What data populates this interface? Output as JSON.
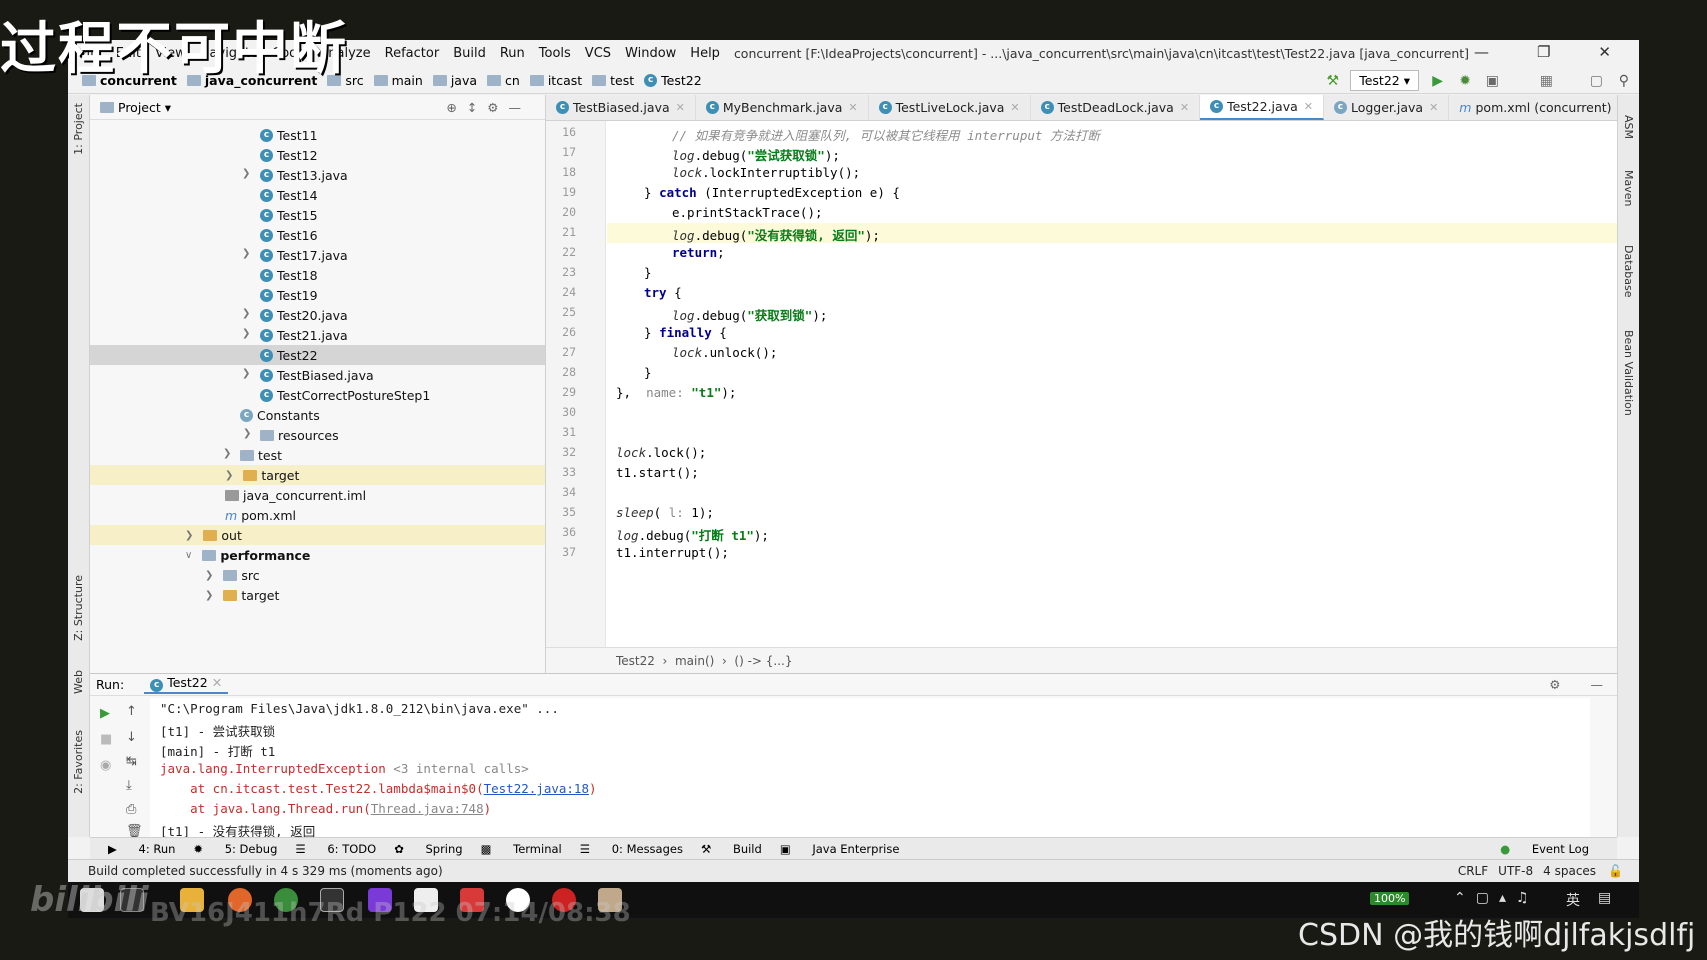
{
  "overlay": {
    "top_left": "过程不可中断",
    "watermark": "BV16J411h7Rd P122 07:14/08:38",
    "footer": "CSDN @我的钱啊djlfakjsdlfj",
    "bilibili": "bilibili"
  },
  "menu": [
    "File",
    "Edit",
    "View",
    "Navigate",
    "Code",
    "Analyze",
    "Refactor",
    "Build",
    "Run",
    "Tools",
    "VCS",
    "Window",
    "Help"
  ],
  "title": "concurrent [F:\\IdeaProjects\\concurrent] - ...\\java_concurrent\\src\\main\\java\\cn\\itcast\\test\\Test22.java [java_concurrent]",
  "breadcrumbs": [
    "concurrent",
    "java_concurrent",
    "src",
    "main",
    "java",
    "cn",
    "itcast",
    "test",
    "Test22"
  ],
  "run_config": "Test22",
  "side_left": [
    "1: Project",
    "Z: Structure",
    "Web",
    "2: Favorites"
  ],
  "side_right": [
    "ASM",
    "Maven",
    "Database",
    "Bean Validation"
  ],
  "project_header": "Project",
  "tree": [
    "Test11",
    "Test12",
    "Test13.java",
    "Test14",
    "Test15",
    "Test16",
    "Test17.java",
    "Test18",
    "Test19",
    "Test20.java",
    "Test21.java",
    "Test22",
    "TestBiased.java",
    "TestCorrectPostureStep1",
    "Constants",
    "resources",
    "test",
    "target",
    "java_concurrent.iml",
    "pom.xml",
    "out",
    "performance",
    "src",
    "target"
  ],
  "tabs": [
    "TestBiased.java",
    "MyBenchmark.java",
    "TestLiveLock.java",
    "TestDeadLock.java",
    "Test22.java",
    "Logger.java",
    "pom.xml (concurrent)"
  ],
  "line_numbers": [
    "16",
    "17",
    "18",
    "19",
    "20",
    "21",
    "22",
    "23",
    "24",
    "25",
    "26",
    "27",
    "28",
    "29",
    "30",
    "31",
    "32",
    "33",
    "34",
    "35",
    "36",
    "37"
  ],
  "code": {
    "l16": "// 如果有竞争就进入阻塞队列, 可以被其它线程用 interruput 方法打断",
    "l17a": "log",
    ".l17b": "",
    "s17": "\"尝试获取锁\"",
    "s21": "\"没有获得锁, 返回\"",
    "s25": "\"获取到锁\"",
    "s29": "\"t1\"",
    "s36": "\"打断 t1\"",
    "hint_name": "name:",
    "hint_l": "l:"
  },
  "editor_breadcrumb": [
    "Test22",
    "main()",
    "() -> {...}"
  ],
  "run": {
    "label": "Run:",
    "tab": "Test22"
  },
  "console": {
    "l1": "\"C:\\Program Files\\Java\\jdk1.8.0_212\\bin\\java.exe\" ...",
    "l2": "[t1] - 尝试获取锁",
    "l3": "[main] - 打断 t1",
    "l4a": "java.lang.InterruptedException",
    "l4b": " <3 internal calls>",
    "l5a": "    at cn.itcast.test.Test22.lambda$main$0(",
    "l5b": "Test22.java:18",
    "l5c": ")",
    "l6a": "    at java.lang.Thread.run(",
    "l6b": "Thread.java:748",
    "l6c": ")",
    "l7": "[t1] - 没有获得锁, 返回"
  },
  "toolwindows": [
    "4: Run",
    "5: Debug",
    "6: TODO",
    "Spring",
    "Terminal",
    "0: Messages",
    "Build",
    "Java Enterprise"
  ],
  "event_log": "Event Log",
  "status": {
    "msg": "Build completed successfully in 4 s 329 ms (moments ago)",
    "crlf": "CRLF",
    "enc": "UTF-8",
    "indent": "4 spaces"
  },
  "tray": {
    "battery": "100%",
    "ime": "英"
  }
}
